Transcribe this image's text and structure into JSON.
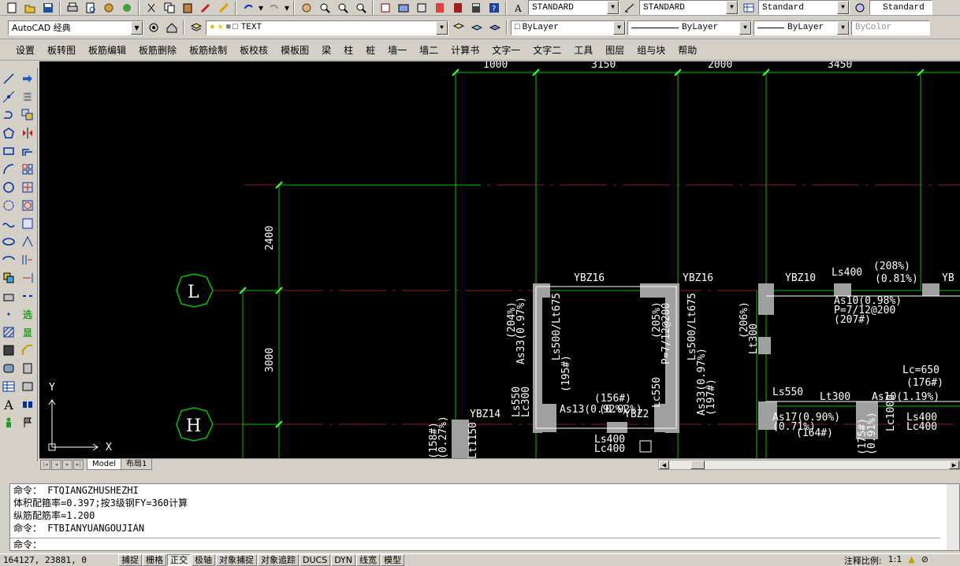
{
  "toolbar1": {
    "text_style": "STANDARD",
    "dim_style": "STANDARD",
    "table_style": "Standard",
    "multileader_style": "Standard"
  },
  "toolbar2": {
    "workspace": "AutoCAD 经典",
    "layer": "TEXT",
    "color": "ByLayer",
    "linetype": "ByLayer",
    "lineweight": "ByLayer",
    "plotstyle": "ByColor"
  },
  "menu": [
    "设置",
    "板转图",
    "板筋编辑",
    "板筋删除",
    "板筋绘制",
    "板校核",
    "模板图",
    "梁",
    "柱",
    "桩",
    "墙一",
    "墙二",
    "计算书",
    "文字一",
    "文字二",
    "工具",
    "图层",
    "组与块",
    "帮助"
  ],
  "drawing": {
    "dims_top": [
      "1000",
      "3150",
      "2000",
      "3450"
    ],
    "dims_left": [
      "2400",
      "3000"
    ],
    "grids": [
      "L",
      "H"
    ],
    "ucs_x": "X",
    "ucs_y": "Y",
    "labels": {
      "ybz16a": "YBZ16",
      "ybz16b": "YBZ16",
      "ybz10": "YBZ10",
      "ybz14": "YBZ14",
      "ybz2": "YBZ2",
      "ybz_edge": "YB",
      "lc650": "Lc=650",
      "ls400a": "Ls400",
      "lc400a": "Lc400",
      "ls400b": "Ls400",
      "lc400b": "Lc400",
      "ls550a": "Ls550",
      "lc550a": "Lc550",
      "ls550b": "Ls550",
      "lt300": "Lt300",
      "lc300": "Lc300",
      "lc1000": "Lc1000",
      "lt1150": "Lt1150",
      "as10a": "As10(0.98%)",
      "pr_a": "P=7/12@200",
      "s207": "(207#)",
      "s208": "(208%)",
      "ls40": "Ls400",
      "pct81": "(0.81%)",
      "as17": "As17(0.90%)",
      "pct71": "(0.71%)",
      "s164": "(164#)",
      "as10b": "As10(1.19%)",
      "s176": "(176#)",
      "s156": "(156#)",
      "as13": "As13(0.92%)",
      "pct092": "(0.92%)",
      "s204": "(204%)",
      "s205": "(205%)",
      "s206": "(206%)",
      "as33a": "As33(0.97%)",
      "as33b": "As33(0.97%)",
      "ls500a": "Ls500/Lt675",
      "ls500b": "Ls500/Lt675",
      "pr_c": "P=7/12@200",
      "s195": "(195#)",
      "s197": "(197#)",
      "lt_mid": "Lt300",
      "s175": "(175#)",
      "pct91": "(0.91%)",
      "s158": "(158#)",
      "pct27": "(0.27%)"
    }
  },
  "tabs": {
    "model": "Model",
    "layout1": "布局1"
  },
  "command": {
    "lines": [
      "命令： FTQIANGZHUSHEZHI",
      "体积配箍率=0.397;按3级钢FY=360计算",
      "纵筋配筋率=1.200",
      "命令： FTBIANYUANGOUJIAN"
    ],
    "prompt": "命令："
  },
  "status": {
    "coords": "164127, 23881, 0",
    "buttons": [
      "捕捉",
      "栅格",
      "正交",
      "极轴",
      "对象捕捉",
      "对象追踪",
      "DUCS",
      "DYN",
      "线宽",
      "模型"
    ],
    "scale_label": "注释比例:",
    "scale_value": "1:1"
  },
  "colors": {
    "canvas": "#000000",
    "grid_green": "#00c000",
    "axis_red": "#8b1a1a",
    "wall_gray": "#a0a0a0",
    "text_white": "#ffffff"
  }
}
